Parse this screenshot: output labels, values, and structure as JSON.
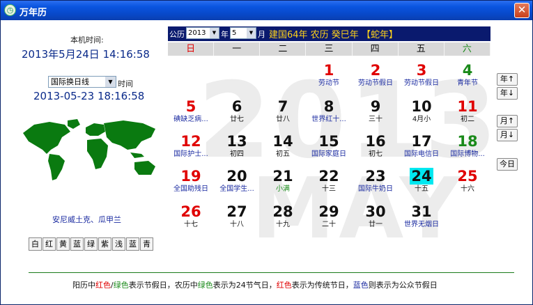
{
  "window": {
    "title": "万年历",
    "close_glyph": "✕",
    "icon": "clock-icon"
  },
  "left": {
    "local_time_label": "本机时间:",
    "local_time": "2013年5月24日  14:16:58",
    "timezone_select": "国际换日线",
    "timezone_label": "时间",
    "timezone_time": "2013-05-23 18:16:58",
    "city": "安尼威土克、瓜甲兰",
    "skins": [
      "白",
      "红",
      "黄",
      "蓝",
      "绿",
      "紫",
      "浅",
      "蓝",
      "青"
    ]
  },
  "header": {
    "solar_label": "公历",
    "year_value": "2013",
    "year_label": "年",
    "month_value": "5",
    "month_label": "月",
    "info": "建国64年  农历  癸巳年  【蛇年】"
  },
  "watermark": {
    "year": "2013",
    "month": "MAY"
  },
  "weekdays": [
    {
      "label": "日",
      "color": "#e00000"
    },
    {
      "label": "一",
      "color": "#111111"
    },
    {
      "label": "二",
      "color": "#111111"
    },
    {
      "label": "三",
      "color": "#111111"
    },
    {
      "label": "四",
      "color": "#111111"
    },
    {
      "label": "五",
      "color": "#111111"
    },
    {
      "label": "六",
      "color": "#1a8a1a"
    }
  ],
  "calendar": {
    "first_weekday": 3,
    "today": 24,
    "days": [
      {
        "d": "1",
        "note": "劳动节",
        "dc": "#e00000",
        "nc": "#1a2aa0"
      },
      {
        "d": "2",
        "note": "劳动节假日",
        "dc": "#e00000",
        "nc": "#1a2aa0"
      },
      {
        "d": "3",
        "note": "劳动节假日",
        "dc": "#e00000",
        "nc": "#1a2aa0"
      },
      {
        "d": "4",
        "note": "青年节",
        "dc": "#1a8a1a",
        "nc": "#1a2aa0"
      },
      {
        "d": "5",
        "note": "碘缺乏病...",
        "dc": "#e00000",
        "nc": "#1a2aa0"
      },
      {
        "d": "6",
        "note": "廿七",
        "dc": "#111111",
        "nc": "#111111"
      },
      {
        "d": "7",
        "note": "廿八",
        "dc": "#111111",
        "nc": "#111111"
      },
      {
        "d": "8",
        "note": "世界红十...",
        "dc": "#111111",
        "nc": "#1a2aa0"
      },
      {
        "d": "9",
        "note": "三十",
        "dc": "#111111",
        "nc": "#111111"
      },
      {
        "d": "10",
        "note": "4月小",
        "dc": "#111111",
        "nc": "#111111"
      },
      {
        "d": "11",
        "note": "初二",
        "dc": "#e00000",
        "nc": "#111111"
      },
      {
        "d": "12",
        "note": "国际护士...",
        "dc": "#e00000",
        "nc": "#1a2aa0"
      },
      {
        "d": "13",
        "note": "初四",
        "dc": "#111111",
        "nc": "#111111"
      },
      {
        "d": "14",
        "note": "初五",
        "dc": "#111111",
        "nc": "#111111"
      },
      {
        "d": "15",
        "note": "国际家庭日",
        "dc": "#111111",
        "nc": "#1a2aa0"
      },
      {
        "d": "16",
        "note": "初七",
        "dc": "#111111",
        "nc": "#111111"
      },
      {
        "d": "17",
        "note": "国际电信日",
        "dc": "#111111",
        "nc": "#1a2aa0"
      },
      {
        "d": "18",
        "note": "国际博物...",
        "dc": "#1a8a1a",
        "nc": "#1a2aa0"
      },
      {
        "d": "19",
        "note": "全国助残日",
        "dc": "#e00000",
        "nc": "#1a2aa0"
      },
      {
        "d": "20",
        "note": "全国学生...",
        "dc": "#111111",
        "nc": "#1a2aa0"
      },
      {
        "d": "21",
        "note": "小满",
        "dc": "#111111",
        "nc": "#1a8a1a"
      },
      {
        "d": "22",
        "note": "十三",
        "dc": "#111111",
        "nc": "#111111"
      },
      {
        "d": "23",
        "note": "国际牛奶日",
        "dc": "#111111",
        "nc": "#1a2aa0"
      },
      {
        "d": "24",
        "note": "十五",
        "dc": "#111111",
        "nc": "#111111"
      },
      {
        "d": "25",
        "note": "十六",
        "dc": "#e00000",
        "nc": "#111111"
      },
      {
        "d": "26",
        "note": "十七",
        "dc": "#e00000",
        "nc": "#111111"
      },
      {
        "d": "27",
        "note": "十八",
        "dc": "#111111",
        "nc": "#111111"
      },
      {
        "d": "28",
        "note": "十九",
        "dc": "#111111",
        "nc": "#111111"
      },
      {
        "d": "29",
        "note": "二十",
        "dc": "#111111",
        "nc": "#111111"
      },
      {
        "d": "30",
        "note": "廿一",
        "dc": "#111111",
        "nc": "#111111"
      },
      {
        "d": "31",
        "note": "世界无烟日",
        "dc": "#111111",
        "nc": "#1a2aa0"
      }
    ]
  },
  "nav": {
    "year_up": "年↑",
    "year_down": "年↓",
    "month_up": "月↑",
    "month_down": "月↓",
    "today": "今日"
  },
  "footer": {
    "parts": [
      {
        "t": "阳历中",
        "c": "#111111"
      },
      {
        "t": "红色",
        "c": "#e00000"
      },
      {
        "t": "/",
        "c": "#111111"
      },
      {
        "t": "绿色",
        "c": "#1a8a1a"
      },
      {
        "t": "表示节假日，农历中",
        "c": "#111111"
      },
      {
        "t": "绿色",
        "c": "#1a8a1a"
      },
      {
        "t": "表示为24节气日，",
        "c": "#111111"
      },
      {
        "t": "红色",
        "c": "#e00000"
      },
      {
        "t": "表示为传统节日，",
        "c": "#111111"
      },
      {
        "t": "蓝色",
        "c": "#1a2aa0"
      },
      {
        "t": "则表示为公众节假日",
        "c": "#111111"
      }
    ]
  },
  "colors": {
    "today_highlight": "#00e8f0",
    "header_bg": "#0a1a6e",
    "header_text": "#ffd21a"
  }
}
